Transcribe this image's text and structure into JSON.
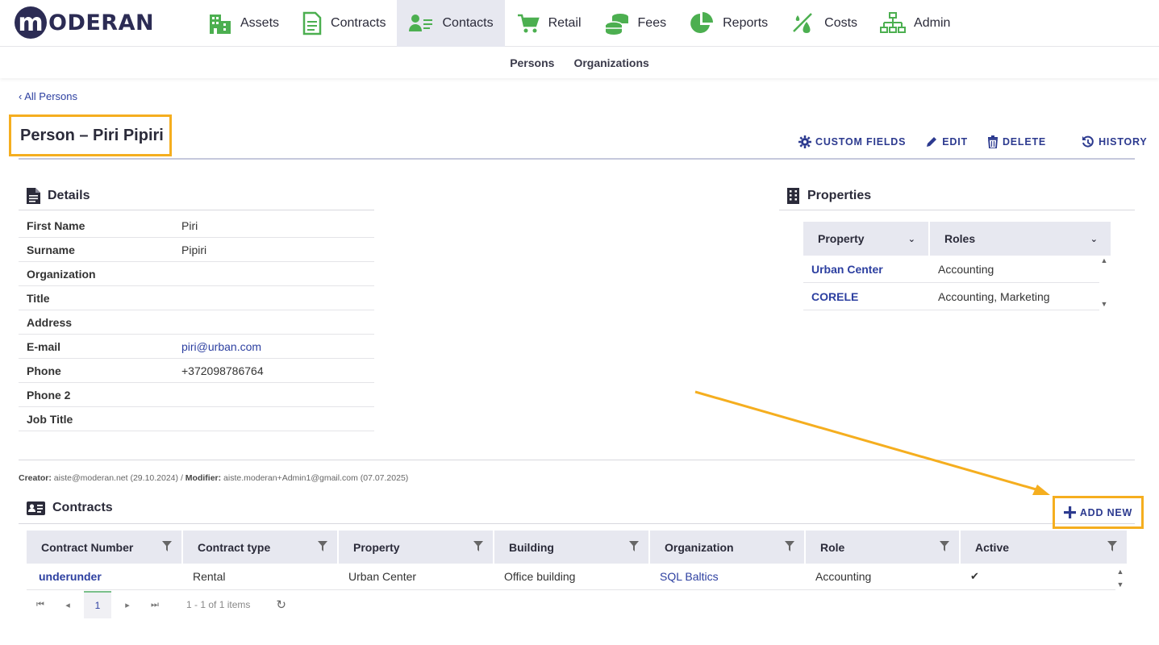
{
  "brand": {
    "logo_letter": "m",
    "logo_text": "ODERAN"
  },
  "nav": [
    {
      "label": "Assets",
      "icon": "building-icon"
    },
    {
      "label": "Contracts",
      "icon": "document-icon"
    },
    {
      "label": "Contacts",
      "icon": "contact-card-icon",
      "active": true
    },
    {
      "label": "Retail",
      "icon": "cart-icon"
    },
    {
      "label": "Fees",
      "icon": "coins-icon"
    },
    {
      "label": "Reports",
      "icon": "pie-chart-icon"
    },
    {
      "label": "Costs",
      "icon": "costs-icon"
    },
    {
      "label": "Admin",
      "icon": "org-chart-icon"
    }
  ],
  "subnav": [
    "Persons",
    "Organizations"
  ],
  "back_link": "All Persons",
  "page_title": "Person – Piri Pipiri",
  "actions": {
    "custom_fields": "CUSTOM FIELDS",
    "edit": "EDIT",
    "delete": "DELETE",
    "history": "HISTORY"
  },
  "details": {
    "heading": "Details",
    "rows": [
      {
        "label": "First Name",
        "value": "Piri"
      },
      {
        "label": "Surname",
        "value": "Pipiri"
      },
      {
        "label": "Organization",
        "value": ""
      },
      {
        "label": "Title",
        "value": ""
      },
      {
        "label": "Address",
        "value": ""
      },
      {
        "label": "E-mail",
        "value": "piri@urban.com"
      },
      {
        "label": "Phone",
        "value": "+372098786764"
      },
      {
        "label": "Phone 2",
        "value": ""
      },
      {
        "label": "Job Title",
        "value": ""
      }
    ]
  },
  "properties": {
    "heading": "Properties",
    "columns": [
      "Property",
      "Roles"
    ],
    "rows": [
      {
        "property": "Urban Center",
        "roles": "Accounting"
      },
      {
        "property": "CORELE",
        "roles": "Accounting, Marketing"
      }
    ]
  },
  "meta": {
    "creator_label": "Creator:",
    "creator": "aiste@moderan.net (29.10.2024)",
    "separator": "/",
    "modifier_label": "Modifier:",
    "modifier": "aiste.moderan+Admin1@gmail.com (07.07.2025)"
  },
  "contracts": {
    "heading": "Contracts",
    "add_new": "ADD NEW",
    "columns": [
      "Contract Number",
      "Contract type",
      "Property",
      "Building",
      "Organization",
      "Role",
      "Active"
    ],
    "rows": [
      {
        "number": "underunder",
        "type": "Rental",
        "property": "Urban Center",
        "building": "Office building",
        "organization": "SQL Baltics",
        "role": "Accounting",
        "active": "✔"
      }
    ]
  },
  "pager": {
    "page": "1",
    "summary": "1 - 1 of 1 items"
  },
  "colors": {
    "accent": "#2c3a8f",
    "highlight": "#f5ae1f",
    "icon_green": "#4caf50",
    "header_bg": "#e7e8f0"
  }
}
